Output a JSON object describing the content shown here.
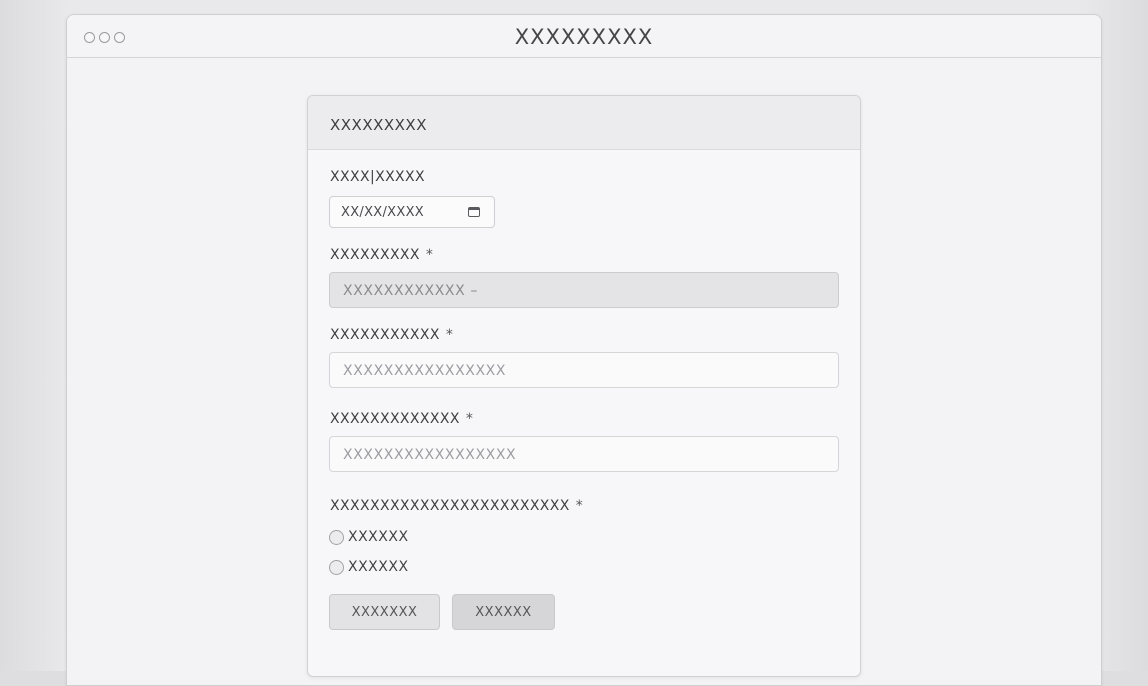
{
  "window": {
    "title": "XXXXXXXXX"
  },
  "form": {
    "title": "XXXXXXXXX",
    "date": {
      "label": "XXXX|XXXXX",
      "value": "XX/XX/XXXX"
    },
    "select": {
      "label": "XXXXXXXXX",
      "required": "*",
      "value": "XXXXXXXXXXXX –"
    },
    "field1": {
      "label": "XXXXXXXXXXX",
      "required": "*",
      "placeholder": "XXXXXXXXXXXXXXXX"
    },
    "field2": {
      "label": "XXXXXXXXXXXXX",
      "required": "*",
      "placeholder": "XXXXXXXXXXXXXXXXX"
    },
    "radio_group": {
      "label": "XXXXXXXXXXXXXXXXXXXXXXXX",
      "required": "*",
      "options": [
        "XXXXXX",
        "XXXXXX"
      ]
    },
    "buttons": {
      "primary_label": "XXXXXXX",
      "secondary_label": "XXXXXX"
    }
  }
}
